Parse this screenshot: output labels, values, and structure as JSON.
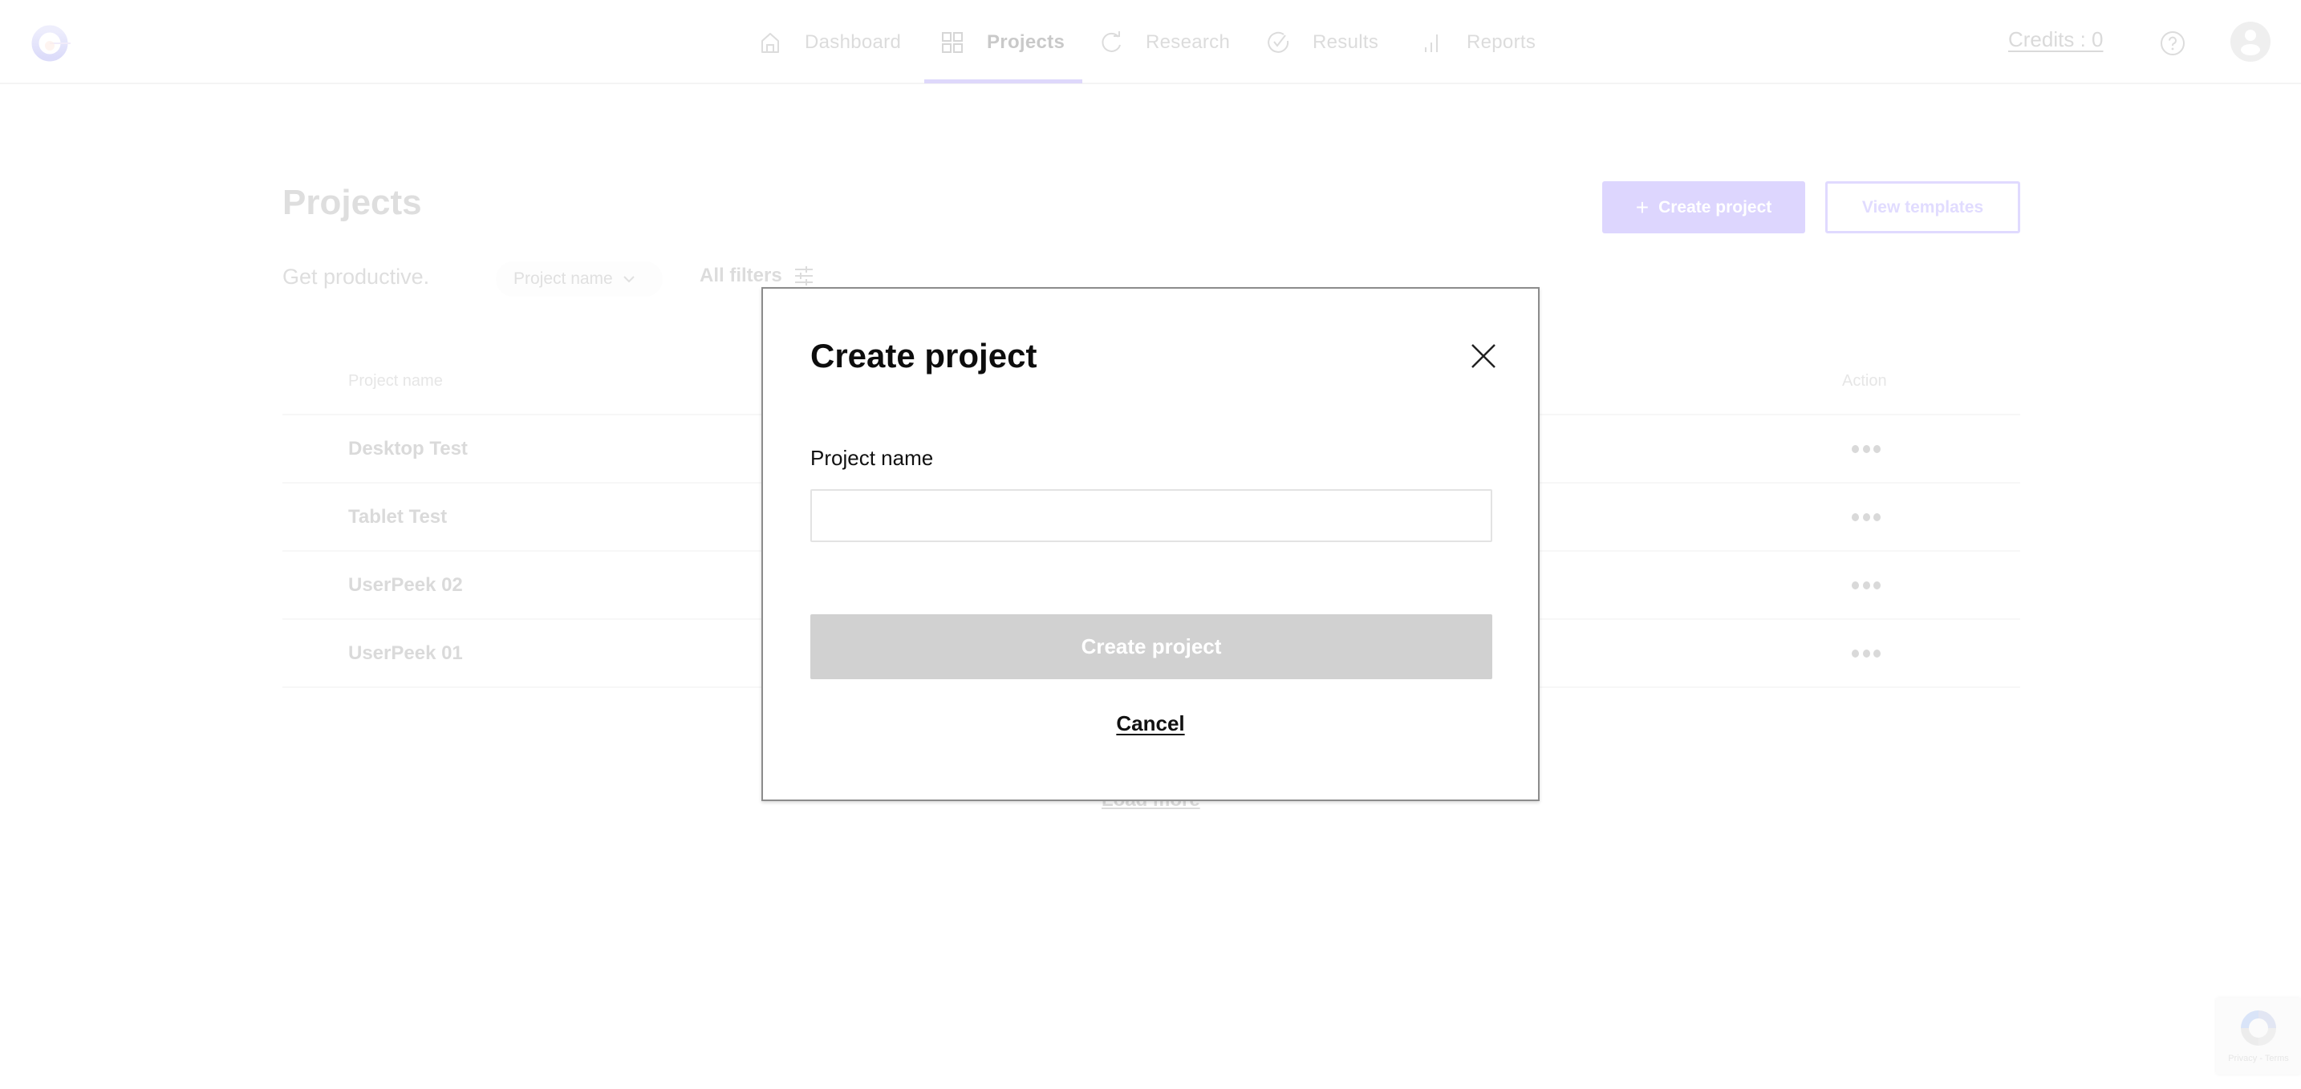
{
  "header": {
    "logo": "brand-logo",
    "nav": [
      {
        "label": "Dashboard",
        "icon": "home-icon",
        "active": false
      },
      {
        "label": "Projects",
        "icon": "grid-icon",
        "active": true
      },
      {
        "label": "Research",
        "icon": "refresh-icon",
        "active": false
      },
      {
        "label": "Results",
        "icon": "check-circle-icon",
        "active": false
      },
      {
        "label": "Reports",
        "icon": "bar-chart-icon",
        "active": false
      }
    ],
    "credits": "Credits : 0",
    "help_icon": "question-circle-icon",
    "avatar_icon": "user-avatar-icon"
  },
  "page": {
    "title": "Projects",
    "subtitle": "Get productive.",
    "sort_dropdown": {
      "selected": "Project name"
    },
    "all_filters_label": "All filters",
    "create_button_label": "Create project",
    "view_templates_label": "View templates",
    "table": {
      "columns": [
        "Project name",
        "Action"
      ],
      "rows": [
        {
          "name": "Desktop Test",
          "action": "more-options"
        },
        {
          "name": "Tablet Test",
          "action": "more-options"
        },
        {
          "name": "UserPeek 02",
          "action": "more-options"
        },
        {
          "name": "UserPeek 01",
          "action": "more-options"
        }
      ]
    },
    "load_more_label": "Load more"
  },
  "modal": {
    "title": "Create project",
    "field_label": "Project name",
    "field_value": "",
    "field_placeholder": "",
    "submit_label": "Create project",
    "submit_disabled": true,
    "cancel_label": "Cancel"
  },
  "recaptcha": {
    "links": "Privacy - Terms"
  },
  "colors": {
    "accent": "#ddd6fe",
    "accent_border": "#e0daff",
    "disabled_button": "#d1d1d1",
    "modal_text": "#0d0d0d"
  }
}
